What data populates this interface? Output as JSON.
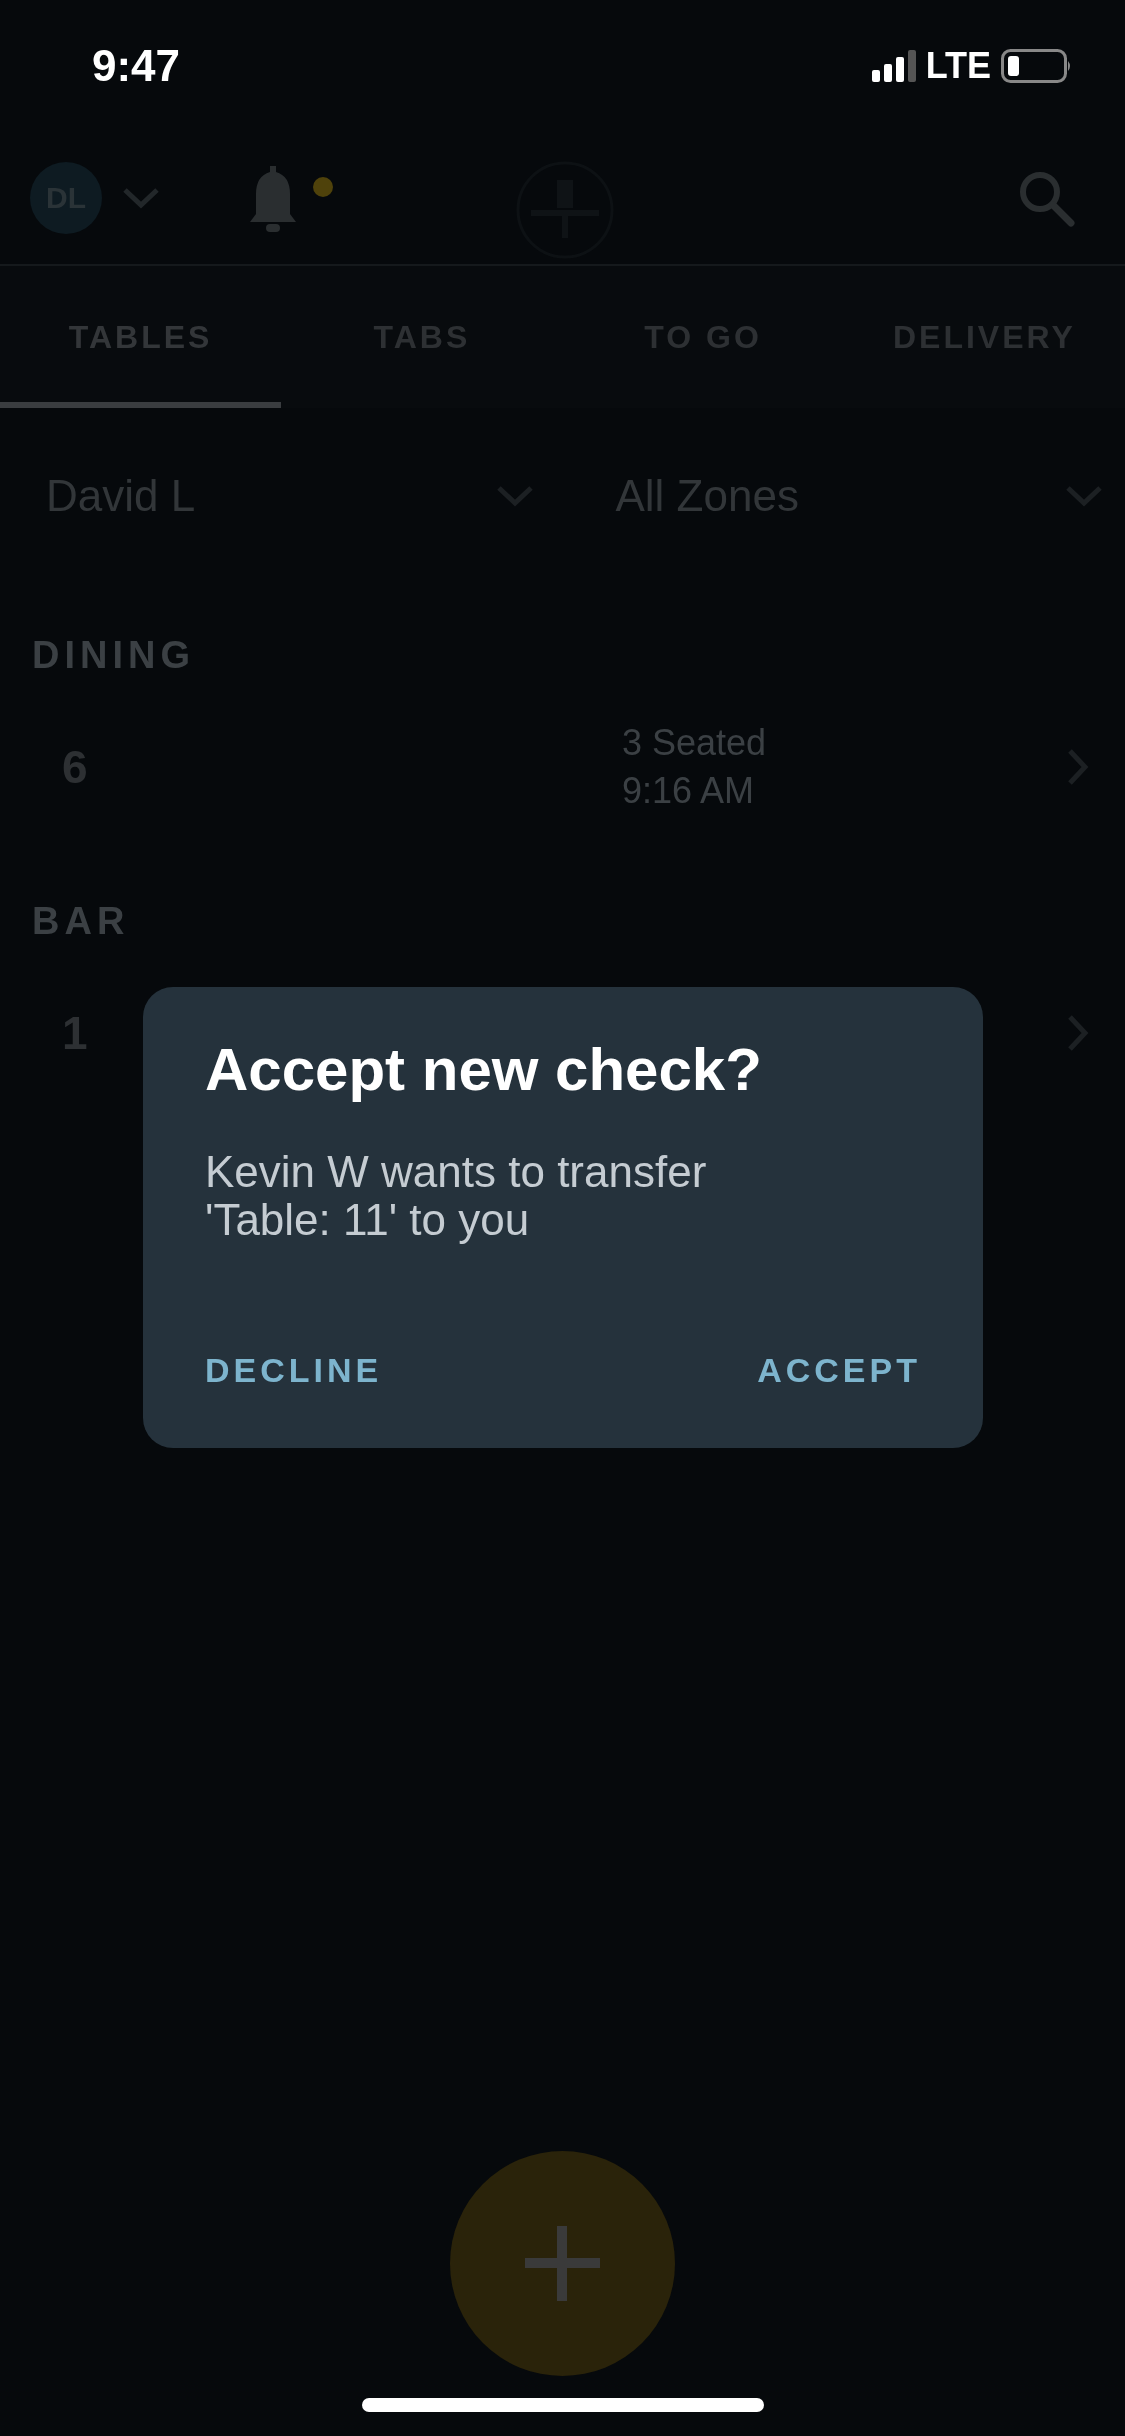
{
  "status_bar": {
    "time": "9:47",
    "network": "LTE"
  },
  "header": {
    "avatar_initials": "DL",
    "has_notification": true
  },
  "tabs": [
    {
      "label": "TABLES",
      "selected": true
    },
    {
      "label": "TABS",
      "selected": false
    },
    {
      "label": "TO GO",
      "selected": false
    },
    {
      "label": "DELIVERY",
      "selected": false
    }
  ],
  "filters": [
    {
      "value": "David L"
    },
    {
      "value": "All Zones"
    }
  ],
  "sections": [
    {
      "title": "DINING",
      "rows": [
        {
          "table": "6",
          "status_lines": [
            "3 Seated",
            "9:16 AM"
          ]
        }
      ]
    },
    {
      "title": "BAR",
      "rows": [
        {
          "table": "1",
          "status_lines": []
        }
      ]
    }
  ],
  "dialog": {
    "title": "Accept new check?",
    "message": "Kevin W wants to transfer 'Table: 11' to you",
    "buttons": [
      {
        "label": "DECLINE"
      },
      {
        "label": "ACCEPT"
      }
    ]
  }
}
